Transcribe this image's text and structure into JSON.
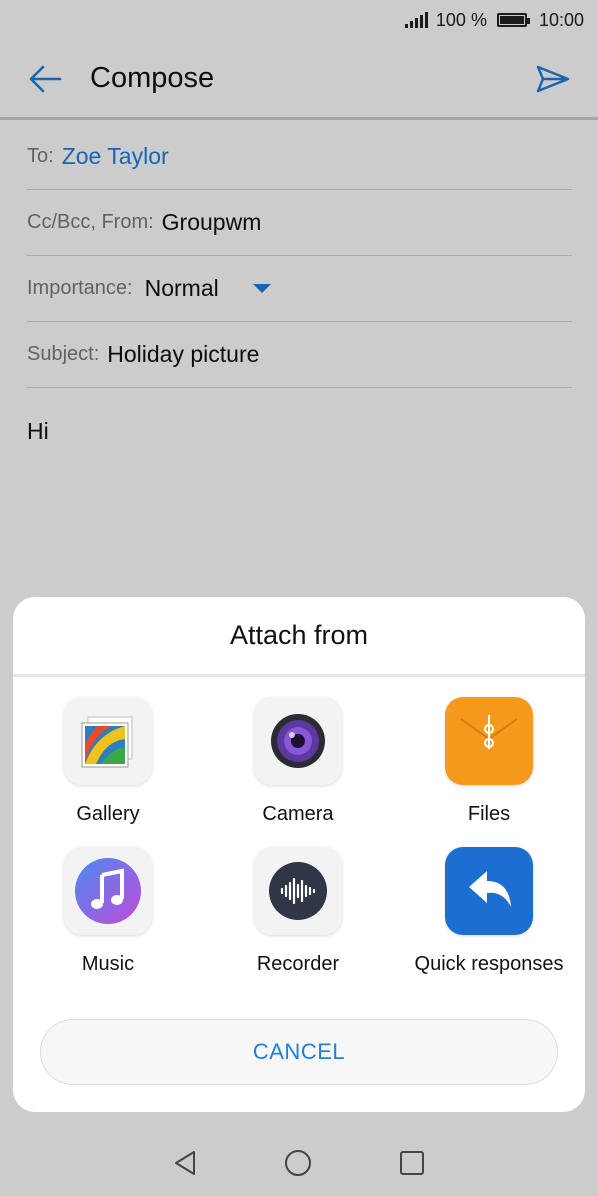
{
  "status_bar": {
    "battery": "100 %",
    "time": "10:00"
  },
  "app_bar": {
    "title": "Compose",
    "back_icon": "back-arrow-icon",
    "send_icon": "send-icon"
  },
  "form": {
    "to_label": "To:",
    "to_value": "Zoe Taylor",
    "ccbcc_label": "Cc/Bcc, From:",
    "from_value": "Groupwm",
    "importance_label": "Importance:",
    "importance_value": "Normal",
    "subject_label": "Subject:",
    "subject_value": "Holiday picture",
    "body": "Hi"
  },
  "sheet": {
    "title": "Attach from",
    "options": [
      {
        "label": "Gallery",
        "icon": "gallery-icon"
      },
      {
        "label": "Camera",
        "icon": "camera-icon"
      },
      {
        "label": "Files",
        "icon": "files-icon"
      },
      {
        "label": "Music",
        "icon": "music-icon"
      },
      {
        "label": "Recorder",
        "icon": "recorder-icon"
      },
      {
        "label": "Quick responses",
        "icon": "quick-responses-icon"
      }
    ],
    "cancel_label": "CANCEL"
  },
  "nav_bar": {
    "back_icon": "nav-back-icon",
    "home_icon": "nav-home-icon",
    "recents_icon": "nav-recents-icon"
  },
  "colors": {
    "accent": "#1d7fe0",
    "files_orange": "#f59a1c",
    "quick_blue": "#1c6fd0"
  }
}
